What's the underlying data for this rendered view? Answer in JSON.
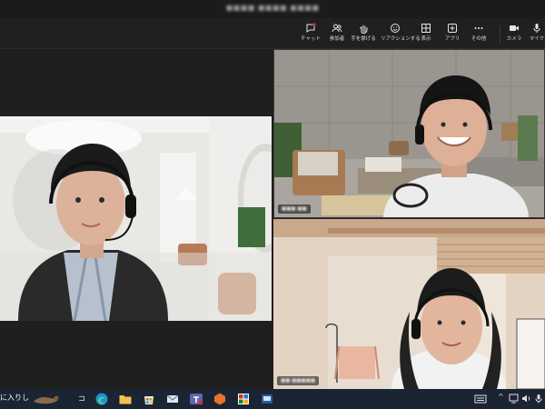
{
  "window": {
    "title": "■■■■ ■■■■ ■■■■"
  },
  "toolbar": {
    "items": [
      {
        "label": "チャット",
        "icon": "chat-icon"
      },
      {
        "label": "参加者",
        "icon": "people-icon"
      },
      {
        "label": "手を挙げる",
        "icon": "raise-hand-icon"
      },
      {
        "label": "リアクションする",
        "icon": "reaction-icon"
      },
      {
        "label": "表示",
        "icon": "view-icon"
      },
      {
        "label": "アプリ",
        "icon": "apps-icon"
      },
      {
        "label": "その他",
        "icon": "more-icon"
      },
      {
        "label": "カメラ",
        "icon": "camera-icon"
      },
      {
        "label": "マイク",
        "icon": "mic-icon"
      }
    ]
  },
  "participants": [
    {
      "name": "■■■■",
      "position": "left"
    },
    {
      "name": "■■■ ■■",
      "position": "right-top"
    },
    {
      "name": "■■ ■■■■■",
      "position": "right-bottom"
    }
  ],
  "taskbar": {
    "left_text": "に入りし",
    "apps": [
      "task-view-icon",
      "edge-icon",
      "file-explorer-icon",
      "store-icon",
      "mail-icon",
      "teams-icon",
      "office-icon",
      "app-icon",
      "app2-icon"
    ],
    "tray": [
      "keyboard-icon",
      "chevron-up-icon",
      "network-icon",
      "volume-icon",
      "mic-tray-icon"
    ]
  },
  "colors": {
    "accent": "#6264a7",
    "background": "#1f1f1f",
    "taskbar": "#1a2433"
  }
}
